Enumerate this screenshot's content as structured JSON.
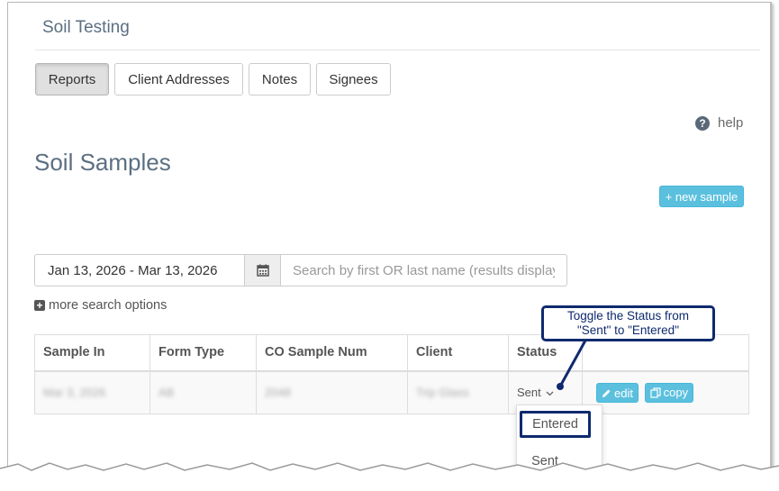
{
  "app": {
    "title": "Soil Testing"
  },
  "tabs": [
    {
      "label": "Reports",
      "active": true
    },
    {
      "label": "Client Addresses",
      "active": false
    },
    {
      "label": "Notes",
      "active": false
    },
    {
      "label": "Signees",
      "active": false
    }
  ],
  "help": {
    "label": "help",
    "icon": "question-circle-icon"
  },
  "page": {
    "title": "Soil Samples"
  },
  "actions": {
    "new_sample_label": "+ new sample"
  },
  "search": {
    "date_range": "Jan 13, 2026 - Mar 13, 2026",
    "calendar_icon": "calendar-icon",
    "placeholder": "Search by first OR last name (results display",
    "more_options_label": "more search options"
  },
  "table": {
    "headers": [
      "Sample In",
      "Form Type",
      "CO Sample Num",
      "Client",
      "Status",
      ""
    ],
    "rows": [
      {
        "sample_in": "Mar 3, 2026",
        "form_type": "AB",
        "co_sample_num": "2048",
        "client": "Trip Glass",
        "status": "Sent",
        "edit_label": "edit",
        "copy_label": "copy"
      }
    ]
  },
  "status_dropdown": {
    "options": [
      "Entered",
      "Sent"
    ],
    "highlighted": "Entered"
  },
  "callout": {
    "line1": "Toggle the Status from",
    "line2": "\"Sent\" to \"Entered\""
  },
  "colors": {
    "accent_info": "#5bc0de",
    "callout": "#0e2a6e",
    "title": "#5b6f82"
  }
}
